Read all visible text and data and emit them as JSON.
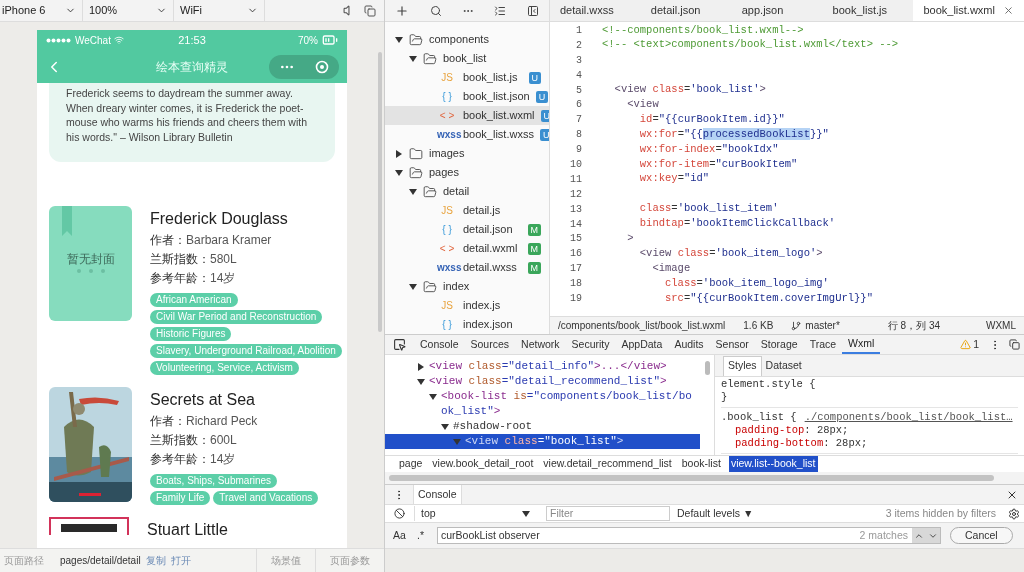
{
  "simulator_toolbar": {
    "selects": [
      {
        "value": "iPhone 6"
      },
      {
        "value": "100%"
      },
      {
        "value": "WiFi"
      }
    ]
  },
  "phone": {
    "status_bar": {
      "carrier": "WeChat",
      "time": "21:53",
      "battery": "70%"
    },
    "nav_bar": {
      "title": "绘本查询精灵"
    },
    "description": "Frederick seems to daydream the summer away. When dreary winter comes, it is Frederick the poet-mouse who warms his friends and cheers them with his words.\" – Wilson Library Bulletin",
    "books": [
      {
        "title": "Frederick Douglass",
        "cover": {
          "kind": "placeholder",
          "label": "暂无封面"
        },
        "fields": [
          {
            "label": "作者：",
            "value": "Barbara Kramer"
          },
          {
            "label": "兰斯指数：",
            "value": "580L"
          },
          {
            "label": "参考年龄：",
            "value": "14岁"
          }
        ],
        "tags": [
          "African American",
          "Civil War Period and Reconstruction",
          "Historic Figures",
          "Slavery, Underground Railroad, Abolition",
          "Volunteering, Service, Activism"
        ]
      },
      {
        "title": "Secrets at Sea",
        "cover": {
          "kind": "picture"
        },
        "fields": [
          {
            "label": "作者：",
            "value": "Richard Peck"
          },
          {
            "label": "兰斯指数：",
            "value": "600L"
          },
          {
            "label": "参考年龄：",
            "value": "14岁"
          }
        ],
        "tags": [
          "Boats, Ships, Submarines",
          "Family Life",
          "Travel and Vacations"
        ]
      },
      {
        "title": "Stuart Little",
        "cover": {
          "kind": "framed"
        }
      }
    ]
  },
  "simulator_footer": {
    "path_label": "页面路径",
    "path": "pages/detail/detail",
    "links": [
      "复制",
      "打开"
    ],
    "buttons": [
      "场景值",
      "页面参数"
    ]
  },
  "file_tree": [
    {
      "name": "components",
      "kind": "folder",
      "expanded": true,
      "selected": false,
      "children": [
        {
          "name": "book_list",
          "kind": "folder",
          "expanded": true,
          "selected": false,
          "children": [
            {
              "name": "book_list.js",
              "kind": "js",
              "type_label": "JS",
              "badge": "U",
              "selected": false
            },
            {
              "name": "book_list.json",
              "kind": "json",
              "type_label": "{ }",
              "badge": "U",
              "selected": false
            },
            {
              "name": "book_list.wxml",
              "kind": "wxml",
              "type_label": "< >",
              "badge": "U",
              "selected": true
            },
            {
              "name": "book_list.wxss",
              "kind": "wxss",
              "type_label": "wxss",
              "badge": "U",
              "selected": false
            }
          ]
        }
      ]
    },
    {
      "name": "images",
      "kind": "folder",
      "expanded": false,
      "selected": false
    },
    {
      "name": "pages",
      "kind": "folder",
      "expanded": true,
      "selected": false,
      "children": [
        {
          "name": "detail",
          "kind": "folder",
          "expanded": true,
          "selected": false,
          "children": [
            {
              "name": "detail.js",
              "kind": "js",
              "type_label": "JS",
              "selected": false
            },
            {
              "name": "detail.json",
              "kind": "json",
              "type_label": "{ }",
              "badge": "M",
              "selected": false
            },
            {
              "name": "detail.wxml",
              "kind": "wxml",
              "type_label": "< >",
              "badge": "M",
              "selected": false
            },
            {
              "name": "detail.wxss",
              "kind": "wxss",
              "type_label": "wxss",
              "badge": "M",
              "selected": false
            }
          ]
        },
        {
          "name": "index",
          "kind": "folder",
          "expanded": true,
          "selected": false,
          "children": [
            {
              "name": "index.js",
              "kind": "js",
              "type_label": "JS",
              "selected": false
            },
            {
              "name": "index.json",
              "kind": "json",
              "type_label": "{ }",
              "selected": false
            }
          ]
        }
      ]
    }
  ],
  "editor": {
    "tabs": [
      {
        "label": "detail.wxss",
        "selected": false
      },
      {
        "label": "detail.json",
        "selected": false
      },
      {
        "label": "app.json",
        "selected": false
      },
      {
        "label": "book_list.js",
        "selected": false
      },
      {
        "label": "book_list.wxml",
        "selected": true
      }
    ],
    "lines": [
      {
        "n": "1",
        "tokens": [
          {
            "kind": "comment",
            "text": "<!--components/book_list.wxml-->"
          }
        ]
      },
      {
        "n": "2",
        "tokens": [
          {
            "kind": "comment",
            "text": "<!-- <text>components/book_list.wxml</text> -->"
          }
        ]
      },
      {
        "n": "3"
      },
      {
        "n": "4"
      },
      {
        "n": "5",
        "tokens": [
          {
            "kind": "tag",
            "text": "  <view "
          },
          {
            "kind": "attr",
            "text": "class"
          },
          {
            "kind": "plain",
            "text": "="
          },
          {
            "kind": "string",
            "text": "'book_list'"
          },
          {
            "kind": "tag",
            "text": ">"
          }
        ]
      },
      {
        "n": "6",
        "tokens": [
          {
            "kind": "tag",
            "text": "    <view"
          }
        ]
      },
      {
        "n": "7",
        "tokens": [
          {
            "kind": "attr",
            "text": "      id"
          },
          {
            "kind": "plain",
            "text": "="
          },
          {
            "kind": "string",
            "text": "\"{{curBookItem.id}}\""
          }
        ]
      },
      {
        "n": "8",
        "tokens": [
          {
            "kind": "attr",
            "text": "      wx:for"
          },
          {
            "kind": "plain",
            "text": "="
          },
          {
            "kind": "string",
            "text": "\"{{"
          },
          {
            "kind": "selection",
            "text": "processedBookList"
          },
          {
            "kind": "string",
            "text": "}}\""
          }
        ]
      },
      {
        "n": "9",
        "tokens": [
          {
            "kind": "attr",
            "text": "      wx:for-index"
          },
          {
            "kind": "plain",
            "text": "="
          },
          {
            "kind": "string",
            "text": "\"bookIdx\""
          }
        ]
      },
      {
        "n": "10",
        "tokens": [
          {
            "kind": "attr",
            "text": "      wx:for-item"
          },
          {
            "kind": "plain",
            "text": "="
          },
          {
            "kind": "string",
            "text": "\"curBookItem\""
          }
        ]
      },
      {
        "n": "11",
        "tokens": [
          {
            "kind": "attr",
            "text": "      wx:key"
          },
          {
            "kind": "plain",
            "text": "="
          },
          {
            "kind": "string",
            "text": "\"id\""
          }
        ]
      },
      {
        "n": "12"
      },
      {
        "n": "13",
        "tokens": [
          {
            "kind": "attr",
            "text": "      class"
          },
          {
            "kind": "plain",
            "text": "="
          },
          {
            "kind": "string",
            "text": "'book_list_item'"
          }
        ]
      },
      {
        "n": "14",
        "tokens": [
          {
            "kind": "attr",
            "text": "      bindtap"
          },
          {
            "kind": "plain",
            "text": "="
          },
          {
            "kind": "string",
            "text": "'bookItemClickCallback'"
          }
        ]
      },
      {
        "n": "15",
        "tokens": [
          {
            "kind": "tag",
            "text": "    >"
          }
        ]
      },
      {
        "n": "16",
        "tokens": [
          {
            "kind": "tag",
            "text": "      <view "
          },
          {
            "kind": "attr",
            "text": "class"
          },
          {
            "kind": "plain",
            "text": "="
          },
          {
            "kind": "string",
            "text": "'book_item_logo'"
          },
          {
            "kind": "tag",
            "text": ">"
          }
        ]
      },
      {
        "n": "17",
        "tokens": [
          {
            "kind": "tag",
            "text": "        <image"
          }
        ]
      },
      {
        "n": "18",
        "tokens": [
          {
            "kind": "attr",
            "text": "          class"
          },
          {
            "kind": "plain",
            "text": "="
          },
          {
            "kind": "string",
            "text": "'book_item_logo_img'"
          }
        ]
      },
      {
        "n": "19",
        "tokens": [
          {
            "kind": "attr",
            "text": "          src"
          },
          {
            "kind": "plain",
            "text": "="
          },
          {
            "kind": "string",
            "text": "\"{{curBookItem.coverImgUrl}}\""
          }
        ]
      }
    ],
    "status_bar": {
      "path": "/components/book_list/book_list.wxml",
      "size": "1.6 KB",
      "branch": "master*",
      "cursor": "行 8，列 34",
      "language": "WXML"
    }
  },
  "devtools": {
    "tabs": [
      {
        "label": "Console",
        "selected": false
      },
      {
        "label": "Sources",
        "selected": false
      },
      {
        "label": "Network",
        "selected": false
      },
      {
        "label": "Security",
        "selected": false
      },
      {
        "label": "AppData",
        "selected": false
      },
      {
        "label": "Audits",
        "selected": false
      },
      {
        "label": "Sensor",
        "selected": false
      },
      {
        "label": "Storage",
        "selected": false
      },
      {
        "label": "Trace",
        "selected": false
      },
      {
        "label": "Wxml",
        "selected": true
      }
    ],
    "warning_count": "1",
    "dom_tree": [
      {
        "tag": "<view",
        "attr": " class",
        "value": "=\"detail_info\"",
        "close": ">...</view>",
        "expanded": false,
        "selected": false
      },
      {
        "tag": "<view",
        "attr": " class",
        "value": "=\"detail_recommend_list\"",
        "close": ">",
        "expanded": true,
        "selected": false,
        "children": [
          {
            "tag": "<book-list",
            "attr": " is",
            "value": "=\"components/book_list/book_list\"",
            "close": ">",
            "expanded": true,
            "selected": false,
            "children": [
              {
                "text": "#shadow-root",
                "expanded": true,
                "selected": false,
                "children": [
                  {
                    "tag": "<view",
                    "attr": " class",
                    "value": "=\"book_list\"",
                    "close": ">",
                    "expanded": true,
                    "selected": true
                  }
                ]
              }
            ]
          }
        ]
      }
    ],
    "style_tabs": [
      {
        "label": "Styles",
        "selected": true
      },
      {
        "label": "Dataset",
        "selected": false
      }
    ],
    "style_rules": [
      {
        "selector": "element.style {",
        "close": "}"
      },
      {
        "selector": ".book_list {",
        "source": "./components/book_list/book_list…",
        "declarations": [
          {
            "property": "padding-top",
            "value": ": 28px;"
          },
          {
            "property": "padding-bottom",
            "value": ": 28px;"
          }
        ]
      }
    ],
    "breadcrumbs": [
      {
        "label": "page",
        "selected": false
      },
      {
        "label": "view.book_detail_root",
        "selected": false
      },
      {
        "label": "view.detail_recommend_list",
        "selected": false
      },
      {
        "label": "book-list",
        "selected": false
      },
      {
        "label": "view.list--book_list",
        "selected": true
      }
    ]
  },
  "console": {
    "tab": "Console",
    "context": "top",
    "filter_placeholder": "Filter",
    "levels": "Default levels ▼",
    "hidden_note": "3 items hidden by filters",
    "search": {
      "case_toggle": "Aa",
      "regex_toggle": ".*",
      "value": "curBookList observer",
      "matches": "2 matches",
      "cancel": "Cancel"
    }
  }
}
